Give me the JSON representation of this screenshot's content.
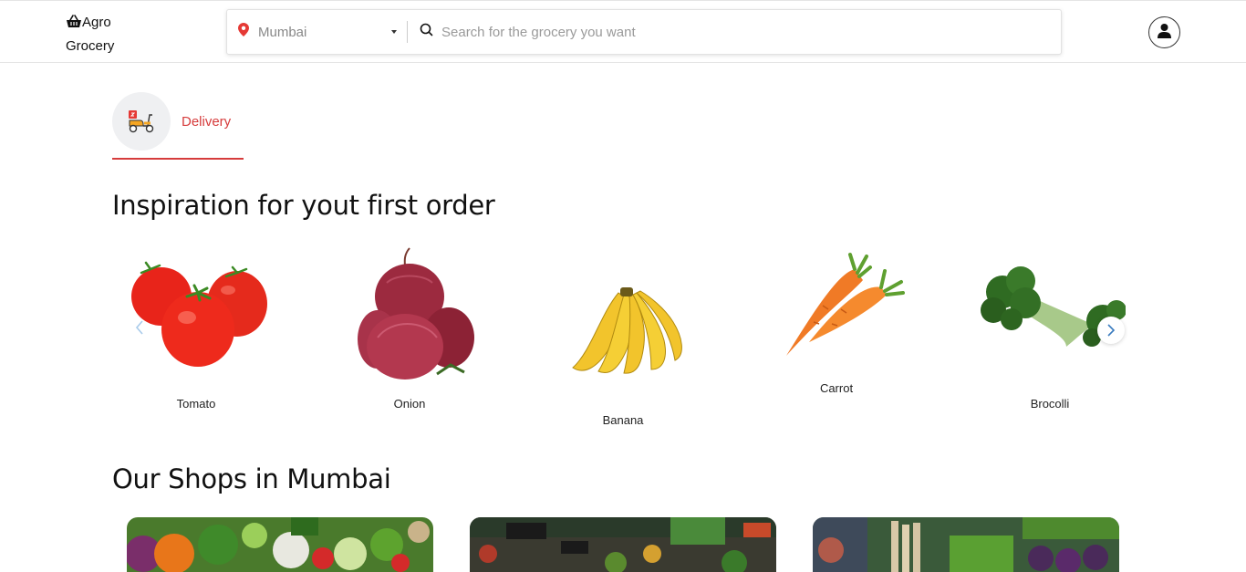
{
  "header": {
    "brand_line1": "Agro",
    "brand_line2": "Grocery",
    "location_value": "Mumbai",
    "search_placeholder": "Search for the grocery you want"
  },
  "tabs": {
    "delivery_label": "Delivery"
  },
  "inspiration": {
    "title": "Inspiration for yout first order",
    "items": [
      {
        "label": "Tomato"
      },
      {
        "label": "Onion"
      },
      {
        "label": "Banana"
      },
      {
        "label": "Carrot"
      },
      {
        "label": "Brocolli"
      }
    ]
  },
  "shops": {
    "title": "Our Shops in Mumbai"
  },
  "colors": {
    "accent": "#d63c3c",
    "pin": "#e53935"
  }
}
